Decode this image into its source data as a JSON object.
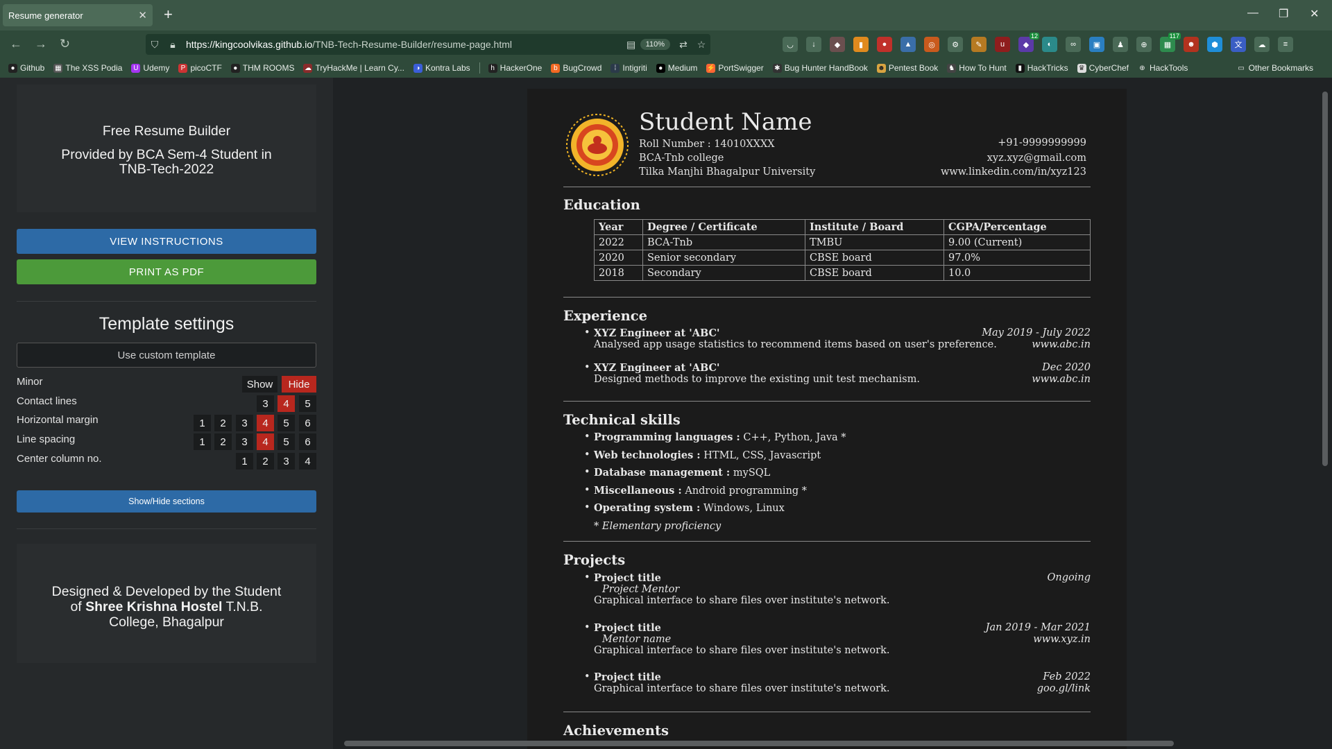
{
  "browser": {
    "tab_title": "Resume generator",
    "url_host": "https://kingcoolvikas.github.io",
    "url_path": "/TNB-Tech-Resume-Builder/resume-page.html",
    "zoom": "110%",
    "extension_badges": {
      "ext_a": "12",
      "ext_b": "117"
    },
    "bookmarks": [
      "Github",
      "The XSS Podia",
      "Udemy",
      "picoCTF",
      "THM ROOMS",
      "TryHackMe | Learn Cy...",
      "Kontra Labs",
      "HackerOne",
      "BugCrowd",
      "Intigriti",
      "Medium",
      "PortSwigger",
      "Bug Hunter HandBook",
      "Pentest Book",
      "How To Hunt",
      "HackTricks",
      "CyberChef",
      "HackTools"
    ],
    "other_bookmarks": "Other Bookmarks"
  },
  "sidebar": {
    "intro_line1": "Free Resume Builder",
    "intro_line2": "Provided by BCA Sem-4 Student in TNB-Tech-2022",
    "view_instructions": "VIEW INSTRUCTIONS",
    "print_pdf": "PRINT AS PDF",
    "template_title": "Template settings",
    "custom_template": "Use custom template",
    "minor_label": "Minor",
    "show_label": "Show",
    "hide_label": "Hide",
    "contact_lines_label": "Contact lines",
    "horizontal_margin_label": "Horizontal margin",
    "line_spacing_label": "Line spacing",
    "center_column_label": "Center column no.",
    "contact_options": [
      "3",
      "4",
      "5"
    ],
    "six_options": [
      "1",
      "2",
      "3",
      "4",
      "5",
      "6"
    ],
    "four_options": [
      "1",
      "2",
      "3",
      "4"
    ],
    "show_hide_sections": "Show/Hide sections",
    "footer_pre": "Designed & Developed by the Student of ",
    "footer_bold": "Shree Krishna Hostel",
    "footer_post": " T.N.B. College, Bhagalpur"
  },
  "resume": {
    "name": "Student Name",
    "roll": "Roll Number : 14010XXXX",
    "college": "BCA-Tnb college",
    "university": "Tilka Manjhi Bhagalpur University",
    "phone": "+91-9999999999",
    "email": "xyz.xyz@gmail.com",
    "linkedin": "www.linkedin.com/in/xyz123",
    "sections": {
      "education": "Education",
      "experience": "Experience",
      "skills": "Technical skills",
      "projects": "Projects",
      "achievements": "Achievements"
    },
    "education": {
      "headers": [
        "Year",
        "Degree / Certificate",
        "Institute / Board",
        "CGPA/Percentage"
      ],
      "rows": [
        [
          "2022",
          "BCA-Tnb",
          "TMBU",
          "9.00 (Current)"
        ],
        [
          "2020",
          "Senior secondary",
          "CBSE board",
          "97.0%"
        ],
        [
          "2018",
          "Secondary",
          "CBSE board",
          "10.0"
        ]
      ]
    },
    "experience": [
      {
        "title": "XYZ Engineer at 'ABC'",
        "date": "May 2019 - July 2022",
        "desc": "Analysed app usage statistics to recommend items based on user's preference.",
        "link": "www.abc.in"
      },
      {
        "title": "XYZ Engineer at 'ABC'",
        "date": "Dec 2020",
        "desc": "Designed methods to improve the existing unit test mechanism.",
        "link": "www.abc.in"
      }
    ],
    "skills": [
      {
        "label": "Programming languages :",
        "value": " C++, Python, Java *"
      },
      {
        "label": "Web technologies :",
        "value": " HTML, CSS, Javascript"
      },
      {
        "label": "Database management :",
        "value": " mySQL"
      },
      {
        "label": "Miscellaneous :",
        "value": " Android programming *"
      },
      {
        "label": "Operating system :",
        "value": " Windows, Linux"
      }
    ],
    "skills_note": "* Elementary proficiency",
    "projects": [
      {
        "title": "Project title",
        "date": "Ongoing",
        "mentor": "Project Mentor",
        "link": "",
        "desc": "Graphical interface to share files over institute's network."
      },
      {
        "title": "Project title",
        "date": "Jan 2019 - Mar 2021",
        "mentor": "Mentor name",
        "link": "www.xyz.in",
        "desc": "Graphical interface to share files over institute's network."
      },
      {
        "title": "Project title",
        "date": "Feb 2022",
        "mentor": "",
        "link": "goo.gl/link",
        "desc": "Graphical interface to share files over institute's network."
      }
    ]
  },
  "colors": {
    "accent_blue": "#2d6aa6",
    "accent_green": "#4c9a3a",
    "selected_red": "#b8271e",
    "browser_green": "#3b5646"
  }
}
